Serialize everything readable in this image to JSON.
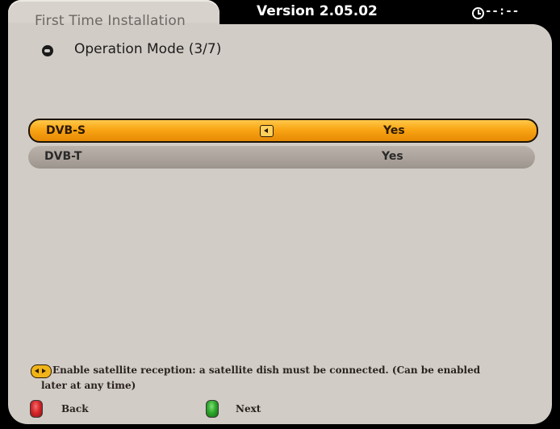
{
  "header": {
    "title": "First Time Installation",
    "version": "Version 2.05.02",
    "clock": "--:--"
  },
  "subtitle": {
    "icon": "back-arrow-icon",
    "text": "Operation Mode (3/7)"
  },
  "list": [
    {
      "label": "DVB-S",
      "value": "Yes",
      "selected": true
    },
    {
      "label": "DVB-T",
      "value": "Yes",
      "selected": false
    }
  ],
  "help": {
    "line1": "Enable satellite reception: a satellite dish must be connected. (Can be enabled",
    "line2": "later at any time)"
  },
  "buttons": {
    "back": {
      "label": "Back",
      "color": "#d8262a"
    },
    "next": {
      "label": "Next",
      "color": "#2fa82c"
    }
  },
  "colors": {
    "panel": "#d2ccc6",
    "selected_row": "#f9a514",
    "normal_row": "#aaa29a"
  }
}
